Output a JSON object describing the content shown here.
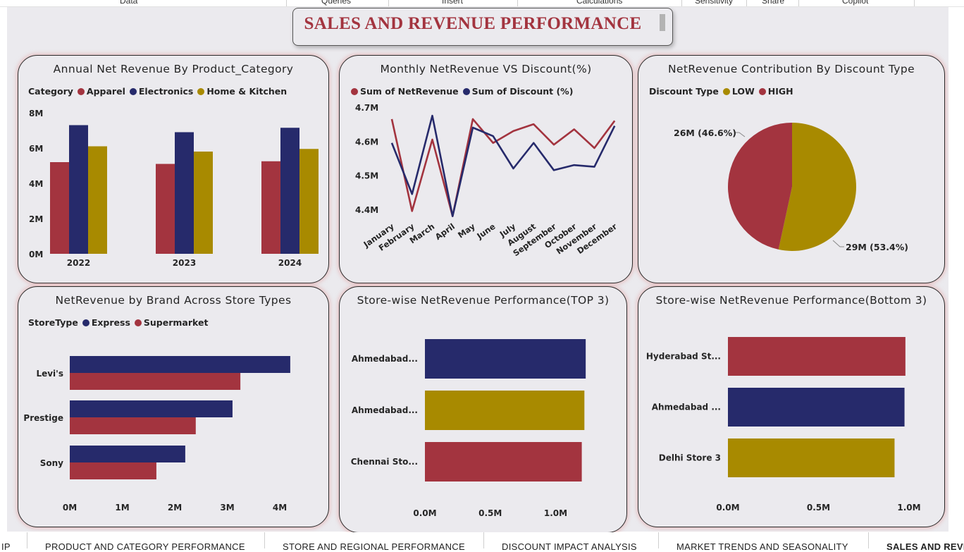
{
  "ribbon": {
    "items": [
      "Data",
      "Queries",
      "Insert",
      "Calculations",
      "Sensitivity",
      "Share",
      "Copilot"
    ]
  },
  "title": "SALES AND REVENUE PERFORMANCE",
  "colors": {
    "red": "#a3343f",
    "navy": "#262a6b",
    "gold": "#a88a00"
  },
  "card1": {
    "title": "Annual Net Revenue By Product_Category",
    "legend_title": "Category",
    "chart_data": {
      "type": "bar",
      "categories": [
        "2022",
        "2023",
        "2024"
      ],
      "series": [
        {
          "name": "Apparel",
          "values": [
            5.2,
            5.1,
            5.25
          ],
          "color": "#a3343f"
        },
        {
          "name": "Electronics",
          "values": [
            7.3,
            6.9,
            7.15
          ],
          "color": "#262a6b"
        },
        {
          "name": "Home & Kitchen",
          "values": [
            6.1,
            5.8,
            5.95
          ],
          "color": "#a88a00"
        }
      ],
      "yticks": [
        "0M",
        "2M",
        "4M",
        "6M",
        "8M"
      ],
      "ylim": [
        0,
        8
      ],
      "unit": "M"
    }
  },
  "card2": {
    "title": "Monthly NetRevenue VS Discount(%)",
    "chart_data": {
      "type": "line",
      "categories": [
        "January",
        "February",
        "March",
        "April",
        "May",
        "June",
        "July",
        "August",
        "September",
        "October",
        "November",
        "December"
      ],
      "series": [
        {
          "name": "Sum of NetRevenue",
          "values": [
            4.665,
            4.395,
            4.605,
            4.38,
            4.665,
            4.595,
            4.63,
            4.65,
            4.59,
            4.635,
            4.58,
            4.66
          ],
          "color": "#a3343f"
        },
        {
          "name": "Sum of Discount (%)",
          "values": [
            4.595,
            4.445,
            4.675,
            4.38,
            4.64,
            4.615,
            4.52,
            4.595,
            4.515,
            4.53,
            4.525,
            4.645
          ],
          "color": "#262a6b"
        }
      ],
      "yticks": [
        "4.4M",
        "4.5M",
        "4.6M",
        "4.7M"
      ],
      "ylim": [
        4.4,
        4.7
      ]
    }
  },
  "card3": {
    "title": "NetRevenue Contribution By Discount Type",
    "legend_title": "Discount Type",
    "chart_data": {
      "type": "pie",
      "slices": [
        {
          "name": "LOW",
          "value": 53.4,
          "label": "29M (53.4%)",
          "color": "#a88a00"
        },
        {
          "name": "HIGH",
          "value": 46.6,
          "label": "26M (46.6%)",
          "color": "#a3343f"
        }
      ]
    }
  },
  "card4": {
    "title": "NetRevenue by Brand Across Store Types",
    "legend_title": "StoreType",
    "chart_data": {
      "type": "bar",
      "orientation": "horizontal",
      "categories": [
        "Levi's",
        "Prestige",
        "Sony"
      ],
      "series": [
        {
          "name": "Express",
          "values": [
            4.2,
            3.1,
            2.2
          ],
          "color": "#262a6b"
        },
        {
          "name": "Supermarket",
          "values": [
            3.25,
            2.4,
            1.65
          ],
          "color": "#a3343f"
        }
      ],
      "xticks": [
        "0M",
        "1M",
        "2M",
        "3M",
        "4M"
      ],
      "xlim": [
        0,
        4
      ]
    }
  },
  "card5": {
    "title": "Store-wise NetRevenue Performance(TOP 3)",
    "chart_data": {
      "type": "bar",
      "orientation": "horizontal",
      "categories": [
        "Ahmedabad...",
        "Ahmedabad...",
        "Chennai Sto..."
      ],
      "values": [
        1.23,
        1.22,
        1.2
      ],
      "colors": [
        "#262a6b",
        "#a88a00",
        "#a3343f"
      ],
      "xticks": [
        "0.0M",
        "0.5M",
        "1.0M"
      ],
      "xlim": [
        0,
        1.0
      ]
    }
  },
  "card6": {
    "title": "Store-wise NetRevenue Performance(Bottom 3)",
    "chart_data": {
      "type": "bar",
      "orientation": "horizontal",
      "categories": [
        "Hyderabad St...",
        "Ahmedabad ...",
        "Delhi Store 3"
      ],
      "values": [
        0.98,
        0.975,
        0.92
      ],
      "colors": [
        "#a3343f",
        "#262a6b",
        "#a88a00"
      ],
      "xticks": [
        "0.0M",
        "0.5M",
        "1.0M"
      ],
      "xlim": [
        0,
        1.0
      ]
    }
  },
  "tabs": [
    "IP",
    "PRODUCT AND CATEGORY PERFORMANCE",
    "STORE AND REGIONAL PERFORMANCE",
    "DISCOUNT IMPACT ANALYSIS",
    "MARKET TRENDS AND SEASONALITY",
    "SALES AND REVE"
  ]
}
